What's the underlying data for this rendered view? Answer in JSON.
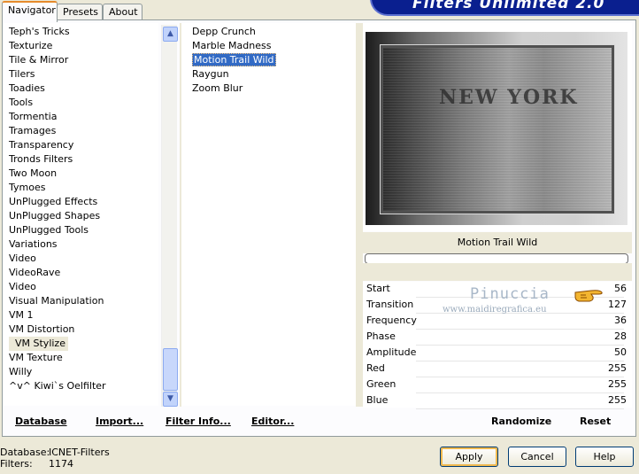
{
  "banner": {
    "title": "Filters Unlimited 2.0"
  },
  "tabs": [
    {
      "label": "Navigator",
      "active": true
    },
    {
      "label": "Presets",
      "active": false
    },
    {
      "label": "About",
      "active": false
    }
  ],
  "categories": [
    "Teph's Tricks",
    "Texturize",
    "Tile & Mirror",
    "Tilers",
    "Toadies",
    "Tools",
    "Tormentia",
    "Tramages",
    "Transparency",
    "Tronds Filters",
    "Two Moon",
    "Tymoes",
    "UnPlugged Effects",
    "UnPlugged Shapes",
    "UnPlugged Tools",
    "Variations",
    "Video",
    "VideoRave",
    "Video",
    "Visual Manipulation",
    "VM 1",
    "VM Distortion",
    "VM Stylize",
    "VM Texture",
    "Willy",
    "^v^ Kiwi`s Oelfilter"
  ],
  "selected_category": "VM Stylize",
  "filters": [
    "Depp Crunch",
    "Marble Madness",
    "Motion Trail Wild",
    "Raygun",
    "Zoom Blur"
  ],
  "selected_filter": "Motion Trail Wild",
  "preview": {
    "text": "NEW YORK"
  },
  "filter_name": "Motion Trail Wild",
  "params": [
    {
      "name": "Start",
      "value": "56"
    },
    {
      "name": "Transition",
      "value": "127"
    },
    {
      "name": "Frequency",
      "value": "36"
    },
    {
      "name": "Phase",
      "value": "28"
    },
    {
      "name": "Amplitude",
      "value": "50"
    },
    {
      "name": "Red",
      "value": "255"
    },
    {
      "name": "Green",
      "value": "255"
    },
    {
      "name": "Blue",
      "value": "255"
    }
  ],
  "watermark": {
    "name": "Pinuccia",
    "url": "www.maidiregrafica.eu"
  },
  "bottom_bar": {
    "database": "Database",
    "import": "Import...",
    "filter_info": "Filter Info...",
    "editor": "Editor...",
    "randomize": "Randomize",
    "reset": "Reset"
  },
  "status": {
    "database_label": "Database:",
    "database_value": "ICNET-Filters",
    "filters_label": "Filters:",
    "filters_value": "1174"
  },
  "buttons": {
    "apply": "Apply",
    "cancel": "Cancel",
    "help": "Help"
  },
  "colors": {
    "selection": "#316ac5",
    "banner": "#0a1f8f",
    "dialog_bg": "#ece9d8"
  }
}
